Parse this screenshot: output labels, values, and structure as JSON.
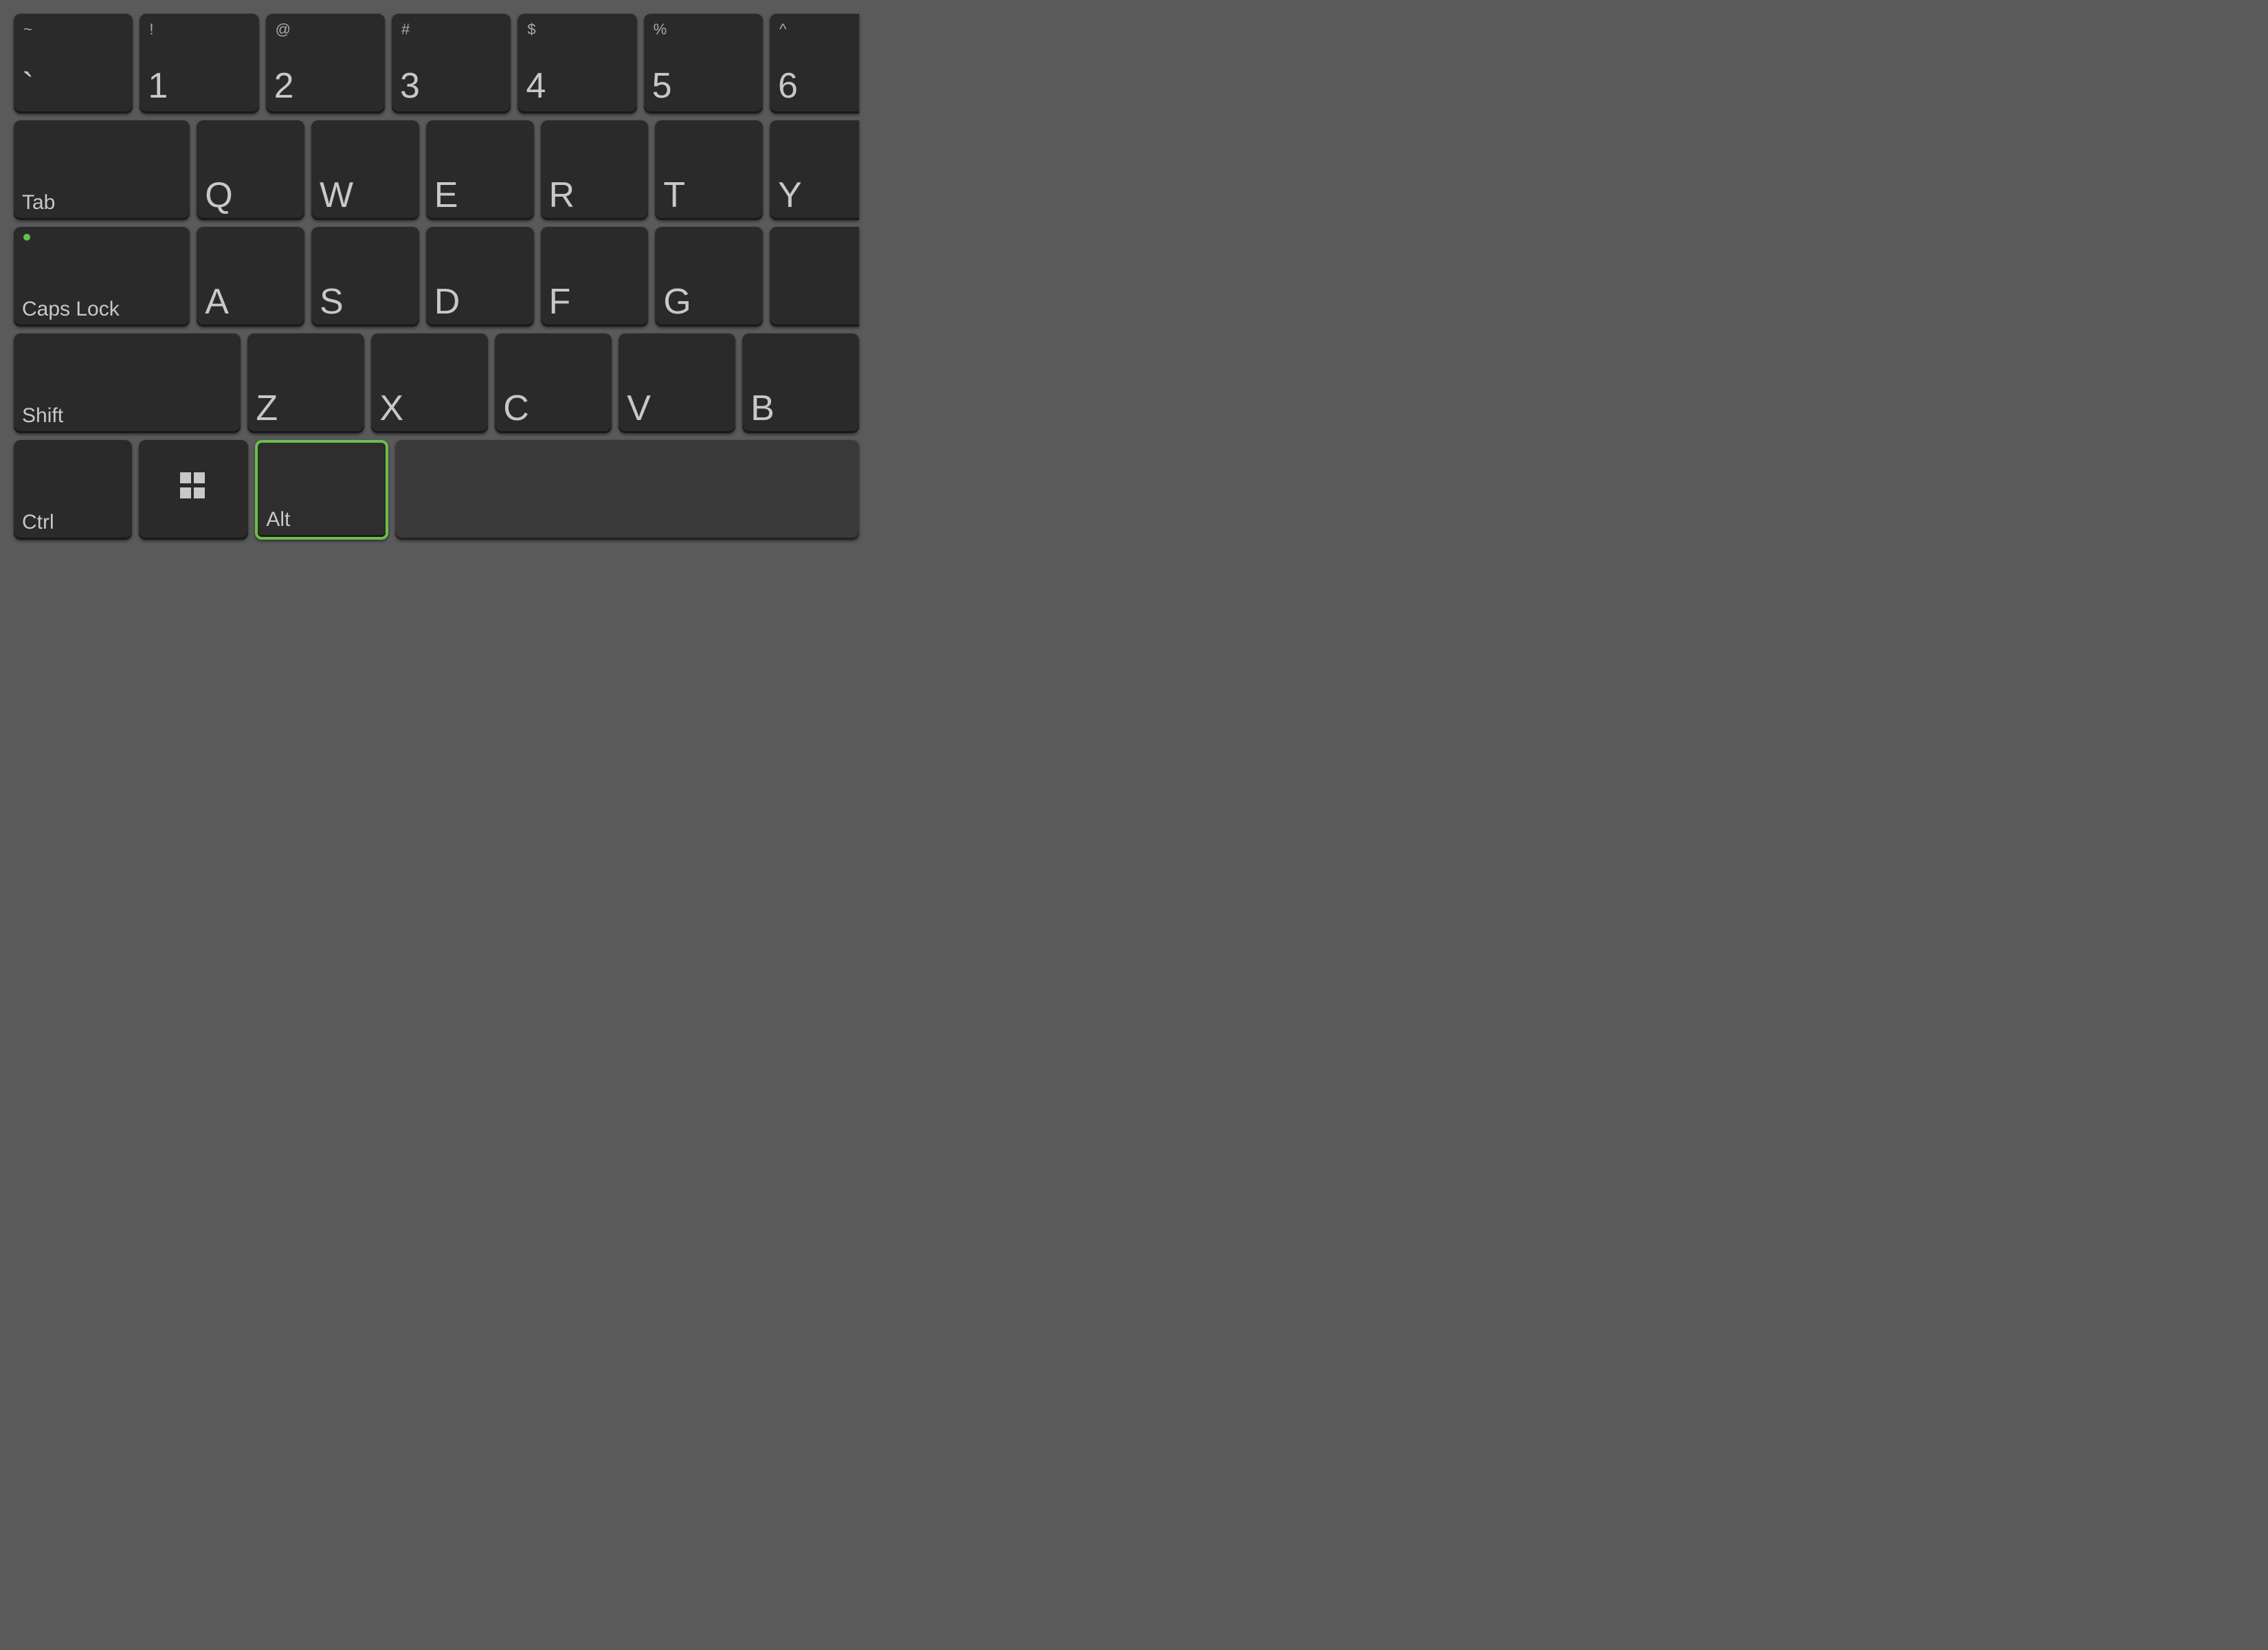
{
  "keyboard": {
    "background": "#5a5a5a",
    "key_bg": "#2a2a2a",
    "key_text_color": "#c8c8c8",
    "highlight_color": "#6abf4b",
    "rows": [
      {
        "id": "row1",
        "keys": [
          {
            "id": "tilde",
            "symbol": "~",
            "main": "`",
            "wide": false
          },
          {
            "id": "1",
            "symbol": "!",
            "main": "1",
            "wide": false
          },
          {
            "id": "2",
            "symbol": "@",
            "main": "2",
            "wide": false
          },
          {
            "id": "3",
            "symbol": "#",
            "main": "3",
            "wide": false
          },
          {
            "id": "4",
            "symbol": "$",
            "main": "4",
            "wide": false
          },
          {
            "id": "5",
            "symbol": "%",
            "main": "5",
            "wide": false
          },
          {
            "id": "6",
            "symbol": "^",
            "main": "6",
            "wide": false,
            "partial": true
          }
        ]
      },
      {
        "id": "row2",
        "keys": [
          {
            "id": "tab",
            "label": "Tab",
            "wide": true
          },
          {
            "id": "q",
            "main": "Q"
          },
          {
            "id": "w",
            "main": "W"
          },
          {
            "id": "e",
            "main": "E"
          },
          {
            "id": "r",
            "main": "R"
          },
          {
            "id": "t",
            "main": "T"
          },
          {
            "id": "y",
            "main": "Y",
            "partial": true
          }
        ]
      },
      {
        "id": "row3",
        "keys": [
          {
            "id": "capslock",
            "label": "Caps Lock",
            "wide": true,
            "indicator": true
          },
          {
            "id": "a",
            "main": "A"
          },
          {
            "id": "s",
            "main": "S"
          },
          {
            "id": "d",
            "main": "D"
          },
          {
            "id": "f",
            "main": "F"
          },
          {
            "id": "g",
            "main": "G"
          },
          {
            "id": "partial_right",
            "main": "",
            "partial": true
          }
        ]
      },
      {
        "id": "row4",
        "keys": [
          {
            "id": "shift",
            "label": "Shift",
            "wider": true
          },
          {
            "id": "z",
            "main": "Z"
          },
          {
            "id": "x",
            "main": "X"
          },
          {
            "id": "c",
            "main": "C"
          },
          {
            "id": "v",
            "main": "V"
          },
          {
            "id": "b",
            "main": "B"
          }
        ]
      },
      {
        "id": "row5",
        "keys": [
          {
            "id": "ctrl",
            "label": "Ctrl",
            "wide": false
          },
          {
            "id": "windows",
            "label": "win"
          },
          {
            "id": "alt",
            "label": "Alt",
            "highlighted": true
          },
          {
            "id": "space",
            "label": "space"
          }
        ]
      }
    ]
  }
}
